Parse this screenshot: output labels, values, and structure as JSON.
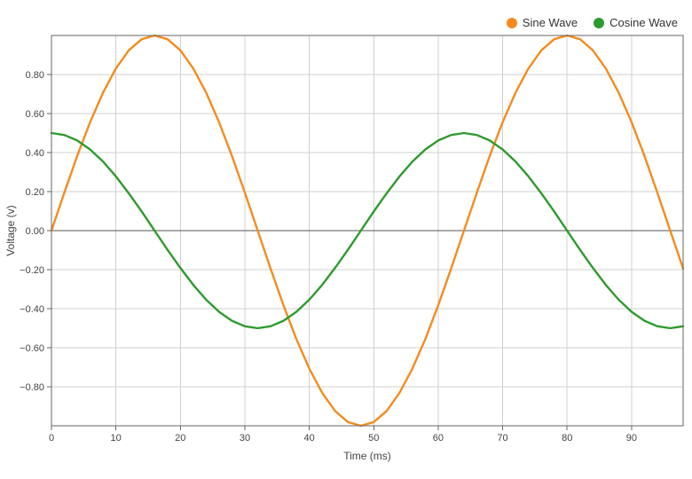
{
  "chart_data": {
    "type": "line",
    "xlabel": "Time (ms)",
    "ylabel": "Voltage (v)",
    "xlim": [
      0,
      98
    ],
    "ylim": [
      -1.0,
      1.0
    ],
    "x_ticks": [
      0,
      10,
      20,
      30,
      40,
      50,
      60,
      70,
      80,
      90
    ],
    "y_ticks": [
      -0.8,
      -0.6,
      -0.4,
      -0.2,
      0.0,
      0.2,
      0.4,
      0.6,
      0.8
    ],
    "y_tick_labels": [
      "−0.80",
      "−0.60",
      "−0.40",
      "−0.20",
      "0.00",
      "0.20",
      "0.40",
      "0.60",
      "0.80"
    ],
    "legend_position": "top-right",
    "x": [
      0,
      2,
      4,
      6,
      8,
      10,
      12,
      14,
      16,
      18,
      20,
      22,
      24,
      26,
      28,
      30,
      32,
      34,
      36,
      38,
      40,
      42,
      44,
      46,
      48,
      50,
      52,
      54,
      56,
      58,
      60,
      62,
      64,
      66,
      68,
      70,
      72,
      74,
      76,
      78,
      80,
      82,
      84,
      86,
      88,
      90,
      92,
      94,
      96,
      98
    ],
    "series": [
      {
        "name": "Sine Wave",
        "color": "#f58b1f",
        "values": [
          0.0,
          0.195,
          0.383,
          0.556,
          0.707,
          0.831,
          0.924,
          0.981,
          1.0,
          0.981,
          0.924,
          0.831,
          0.707,
          0.556,
          0.383,
          0.195,
          0.0,
          -0.195,
          -0.383,
          -0.556,
          -0.707,
          -0.831,
          -0.924,
          -0.981,
          -1.0,
          -0.981,
          -0.924,
          -0.831,
          -0.707,
          -0.556,
          -0.383,
          -0.195,
          0.0,
          0.195,
          0.383,
          0.556,
          0.707,
          0.831,
          0.924,
          0.981,
          1.0,
          0.981,
          0.924,
          0.831,
          0.707,
          0.556,
          0.383,
          0.195,
          0.0,
          -0.195
        ]
      },
      {
        "name": "Cosine Wave",
        "color": "#2e9b2e",
        "values": [
          0.5,
          0.49,
          0.462,
          0.416,
          0.354,
          0.278,
          0.191,
          0.098,
          0.0,
          -0.098,
          -0.191,
          -0.278,
          -0.354,
          -0.416,
          -0.462,
          -0.49,
          -0.5,
          -0.49,
          -0.462,
          -0.416,
          -0.354,
          -0.278,
          -0.191,
          -0.098,
          0.0,
          0.098,
          0.191,
          0.278,
          0.354,
          0.416,
          0.462,
          0.49,
          0.5,
          0.49,
          0.462,
          0.416,
          0.354,
          0.278,
          0.191,
          0.098,
          0.0,
          -0.098,
          -0.191,
          -0.278,
          -0.354,
          -0.416,
          -0.462,
          -0.49,
          -0.5,
          -0.49
        ]
      }
    ]
  }
}
